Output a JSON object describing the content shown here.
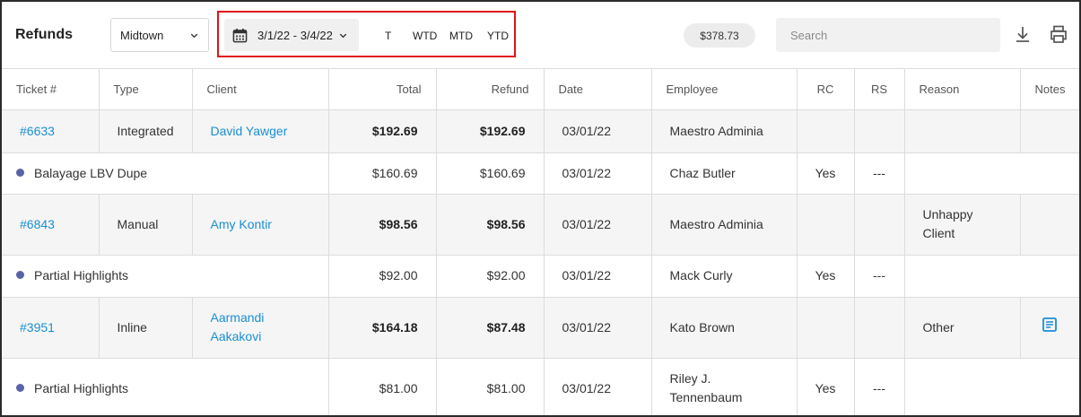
{
  "header": {
    "title": "Refunds",
    "location": "Midtown",
    "date_range": "3/1/22 - 3/4/22",
    "presets": [
      "T",
      "WTD",
      "MTD",
      "YTD"
    ],
    "total": "$378.73",
    "search_placeholder": "Search"
  },
  "columns": [
    "Ticket #",
    "Type",
    "Client",
    "Total",
    "Refund",
    "Date",
    "Employee",
    "RC",
    "RS",
    "Reason",
    "Notes"
  ],
  "rows": [
    {
      "ticket": "#6633",
      "type": "Integrated",
      "client": "David Yawger",
      "total": "$192.69",
      "refund": "$192.69",
      "date": "03/01/22",
      "employee": "Maestro Adminia",
      "reason": ""
    },
    {
      "item": "Balayage LBV Dupe",
      "total": "$160.69",
      "refund": "$160.69",
      "date": "03/01/22",
      "employee": "Chaz Butler",
      "rc": "Yes",
      "rs": "---"
    },
    {
      "ticket": "#6843",
      "type": "Manual",
      "client": "Amy Kontir",
      "total": "$98.56",
      "refund": "$98.56",
      "date": "03/01/22",
      "employee": "Maestro Adminia",
      "reason": "Unhappy Client"
    },
    {
      "item": "Partial Highlights",
      "total": "$92.00",
      "refund": "$92.00",
      "date": "03/01/22",
      "employee": "Mack Curly",
      "rc": "Yes",
      "rs": "---"
    },
    {
      "ticket": "#3951",
      "type": "Inline",
      "client": "Aarmandi Aakakovi",
      "total": "$164.18",
      "refund": "$87.48",
      "date": "03/01/22",
      "employee": "Kato Brown",
      "reason": "Other",
      "note_icon": "note-icon"
    },
    {
      "item": "Partial Highlights",
      "total": "$81.00",
      "refund": "$81.00",
      "date": "03/01/22",
      "employee": "Riley J. Tennenbaum",
      "rc": "Yes",
      "rs": "---"
    }
  ],
  "colors": {
    "link": "#1a8fd3",
    "dot": "#5b63a8",
    "highlight_border": "#e0141a",
    "row_bg": "#f5f5f5"
  }
}
